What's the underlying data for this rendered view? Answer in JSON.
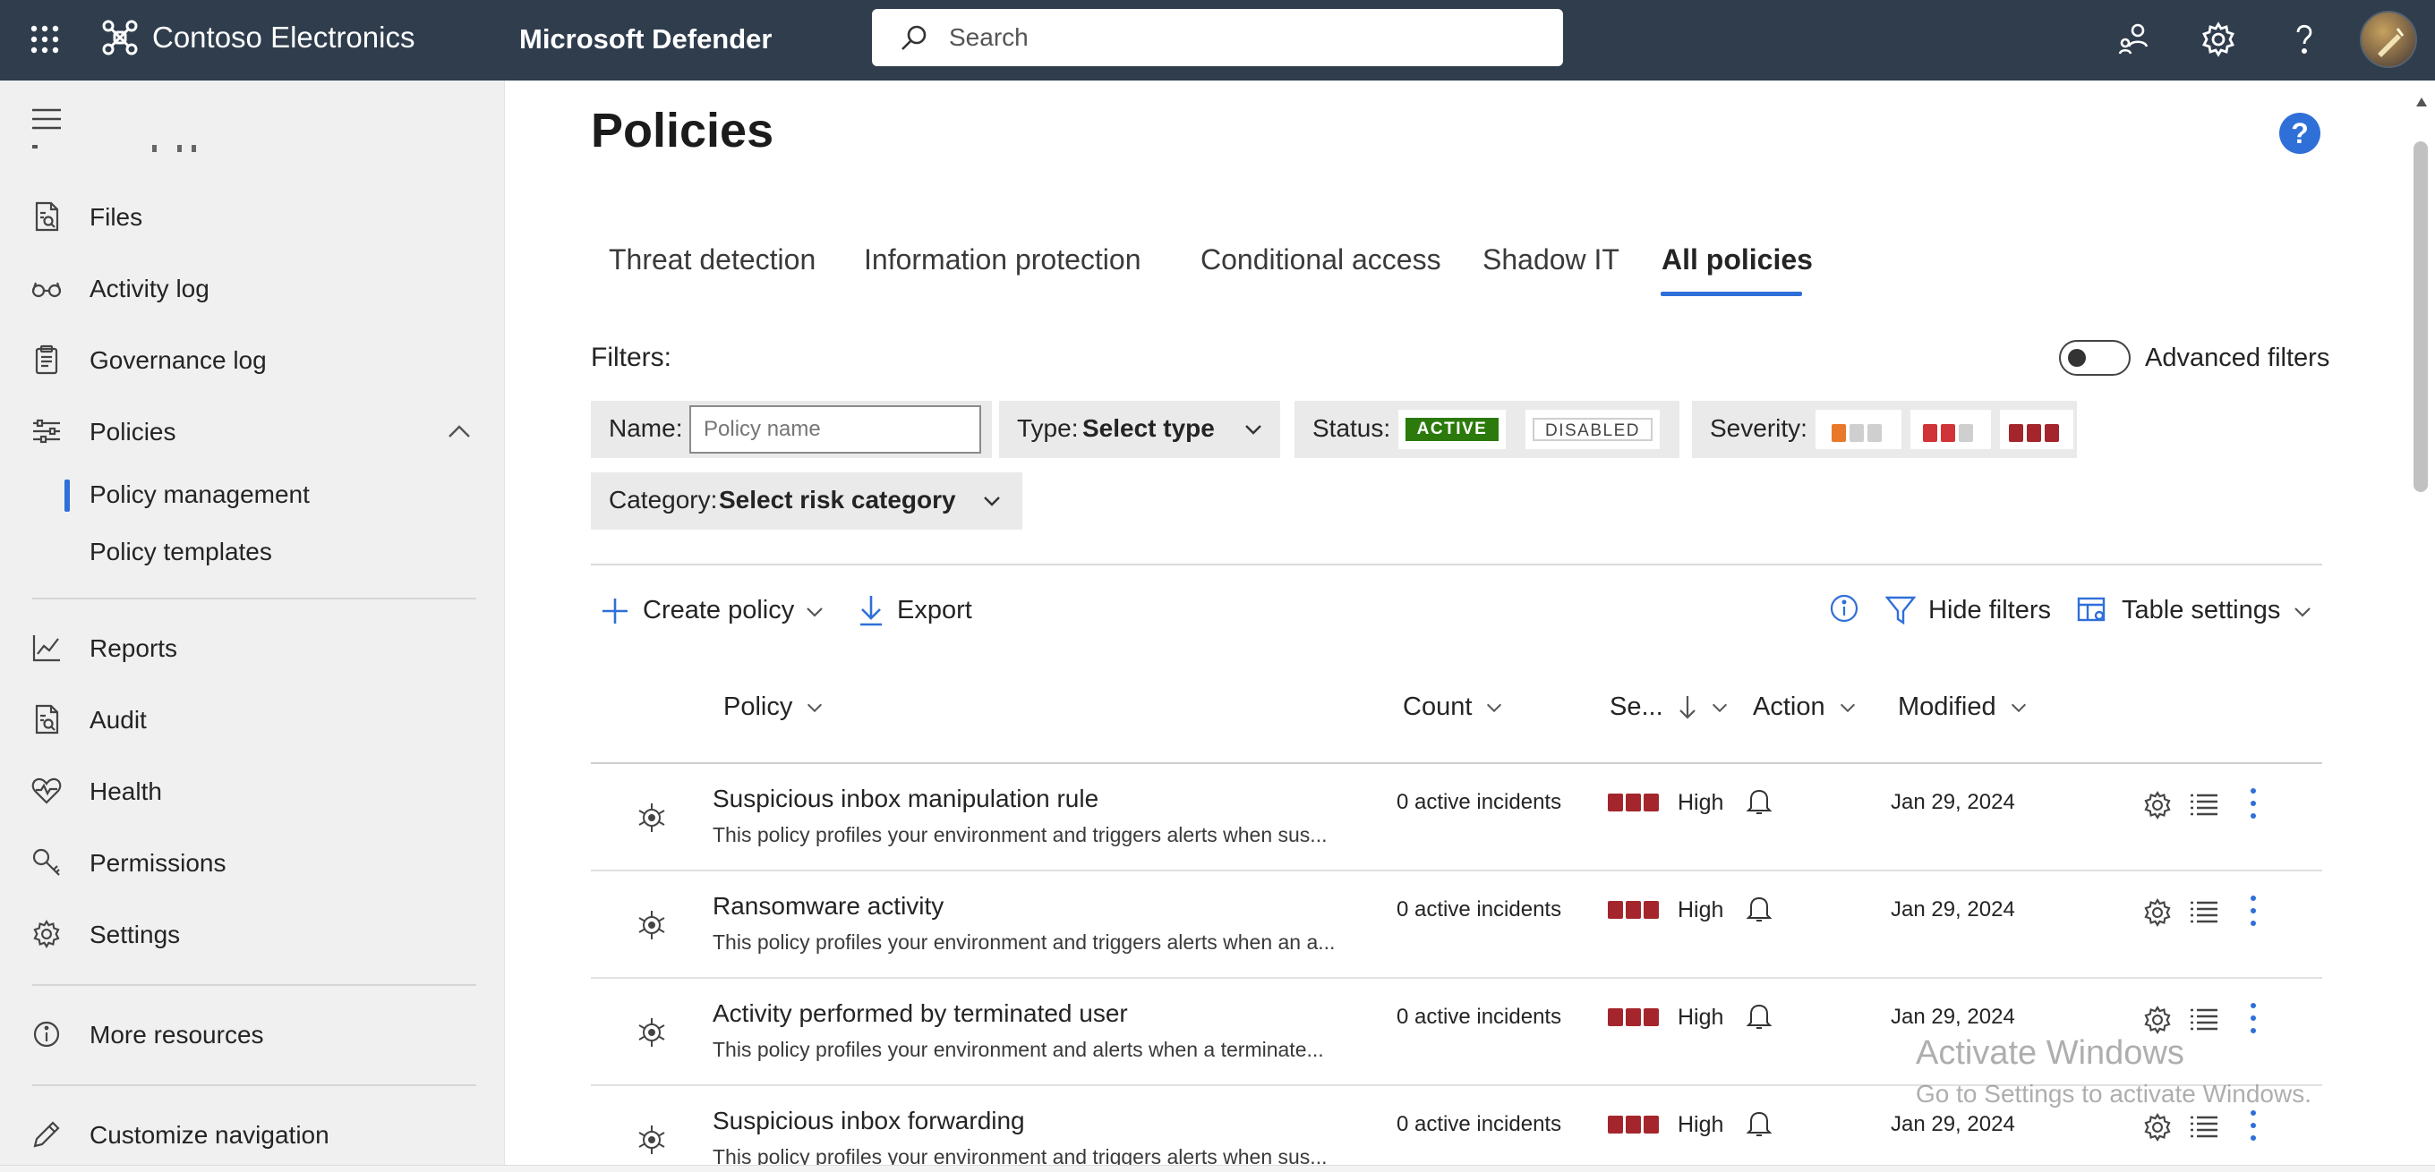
{
  "header": {
    "org_name": "Contoso Electronics",
    "app_name": "Microsoft Defender",
    "search_placeholder": "Search",
    "icons": [
      "waffle-icon",
      "org-logo-icon",
      "search-icon",
      "community-icon",
      "gear-icon",
      "help-icon",
      "avatar"
    ]
  },
  "sidebar": {
    "items": [
      {
        "label": "Files",
        "icon": "file-search-icon"
      },
      {
        "label": "Activity log",
        "icon": "glasses-icon"
      },
      {
        "label": "Governance log",
        "icon": "clipboard-icon"
      },
      {
        "label": "Policies",
        "icon": "sliders-icon",
        "expanded": true
      },
      {
        "label": "Reports",
        "icon": "chart-icon"
      },
      {
        "label": "Audit",
        "icon": "file-search-icon"
      },
      {
        "label": "Health",
        "icon": "heart-pulse-icon"
      },
      {
        "label": "Permissions",
        "icon": "key-icon"
      },
      {
        "label": "Settings",
        "icon": "gear-icon"
      },
      {
        "label": "More resources",
        "icon": "info-icon"
      },
      {
        "label": "Customize navigation",
        "icon": "pencil-icon"
      }
    ],
    "sub_items": [
      {
        "label": "Policy management",
        "active": true
      },
      {
        "label": "Policy templates",
        "active": false
      }
    ]
  },
  "main": {
    "title": "Policies",
    "help_label": "?",
    "tabs": [
      {
        "label": "Threat detection",
        "active": false
      },
      {
        "label": "Information protection",
        "active": false
      },
      {
        "label": "Conditional access",
        "active": false
      },
      {
        "label": "Shadow IT",
        "active": false
      },
      {
        "label": "All policies",
        "active": true
      }
    ],
    "filters": {
      "label": "Filters:",
      "advanced_label": "Advanced filters",
      "advanced_on": false,
      "name_label": "Name:",
      "name_placeholder": "Policy name",
      "type_label": "Type:",
      "type_value": "Select type",
      "status_label": "Status:",
      "status_active": "ACTIVE",
      "status_disabled": "DISABLED",
      "severity_label": "Severity:",
      "category_label": "Category:",
      "category_value": "Select risk category"
    },
    "commands": {
      "create": "Create policy",
      "export": "Export",
      "hide_filters": "Hide filters",
      "table_settings": "Table settings"
    },
    "columns": {
      "policy": "Policy",
      "count": "Count",
      "severity": "Se...",
      "action": "Action",
      "modified": "Modified"
    },
    "rows": [
      {
        "name": "Suspicious inbox manipulation rule",
        "desc": "This policy profiles your environment and triggers alerts when sus...",
        "count": "0 active incidents",
        "severity": "High",
        "modified": "Jan 29, 2024"
      },
      {
        "name": "Ransomware activity",
        "desc": "This policy profiles your environment and triggers alerts when an a...",
        "count": "0 active incidents",
        "severity": "High",
        "modified": "Jan 29, 2024"
      },
      {
        "name": "Activity performed by terminated user",
        "desc": "This policy profiles your environment and alerts when a terminate...",
        "count": "0 active incidents",
        "severity": "High",
        "modified": "Jan 29, 2024"
      },
      {
        "name": "Suspicious inbox forwarding",
        "desc": "This policy profiles your environment and triggers alerts when sus...",
        "count": "0 active incidents",
        "severity": "High",
        "modified": "Jan 29, 2024"
      }
    ]
  },
  "watermark": {
    "line1": "Activate Windows",
    "line2": "Go to Settings to activate Windows."
  },
  "colors": {
    "topbar": "#2f3d4d",
    "accent": "#2f6fd8",
    "status_active": "#2b7a0b",
    "severity_high": "#a4262c",
    "severity_medium": "#d13438",
    "severity_low": "#e8792b"
  }
}
